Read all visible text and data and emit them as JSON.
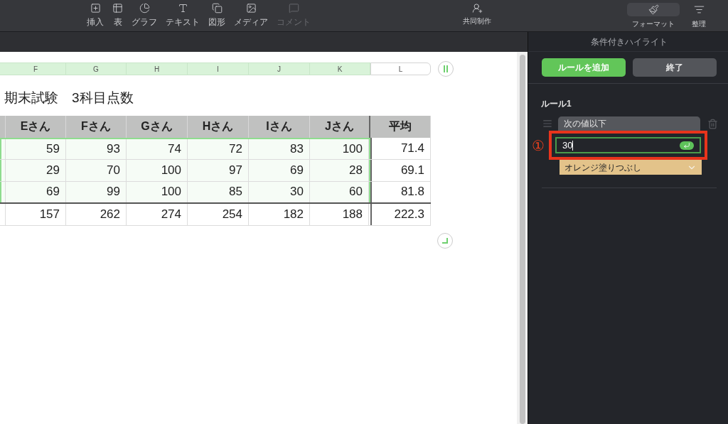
{
  "toolbar": {
    "left_items": [
      {
        "label": "挿入",
        "disabled": false
      },
      {
        "label": "表",
        "disabled": false
      },
      {
        "label": "グラフ",
        "disabled": false
      },
      {
        "label": "テキスト",
        "disabled": false
      },
      {
        "label": "図形",
        "disabled": false
      },
      {
        "label": "メディア",
        "disabled": false
      },
      {
        "label": "コメント",
        "disabled": true
      }
    ],
    "center_item": {
      "label": "共同制作"
    },
    "right_items": [
      {
        "label": "フォーマット",
        "selected": true
      },
      {
        "label": "整理",
        "selected": false
      }
    ]
  },
  "column_letters": [
    {
      "label": "F",
      "selected": true
    },
    {
      "label": "G",
      "selected": true
    },
    {
      "label": "H",
      "selected": true
    },
    {
      "label": "I",
      "selected": true
    },
    {
      "label": "J",
      "selected": true
    },
    {
      "label": "K",
      "selected": true
    },
    {
      "label": "L",
      "selected": false
    }
  ],
  "table": {
    "title": "期末試験　3科目点数",
    "headers": [
      "Eさん",
      "Fさん",
      "Gさん",
      "Hさん",
      "Iさん",
      "Jさん",
      "平均"
    ],
    "rows": [
      {
        "selected": true,
        "cells": [
          "59",
          "93",
          "74",
          "72",
          "83",
          "100",
          "71.4"
        ]
      },
      {
        "selected": true,
        "cells": [
          "29",
          "70",
          "100",
          "97",
          "69",
          "28",
          "69.1"
        ]
      },
      {
        "selected": true,
        "cells": [
          "69",
          "99",
          "100",
          "85",
          "30",
          "60",
          "81.8"
        ]
      },
      {
        "selected": false,
        "cells": [
          "157",
          "262",
          "274",
          "254",
          "182",
          "188",
          "222.3"
        ]
      }
    ]
  },
  "panel": {
    "title": "条件付きハイライト",
    "buttons": [
      {
        "label": "ルールを追加",
        "kind": "primary"
      },
      {
        "label": "終了",
        "kind": "secondary"
      }
    ],
    "rule": {
      "title": "ルール1",
      "condition": "次の値以下",
      "value": "30",
      "style": "オレンジ塗りつぶし"
    },
    "annotation": {
      "marker": "①"
    }
  }
}
